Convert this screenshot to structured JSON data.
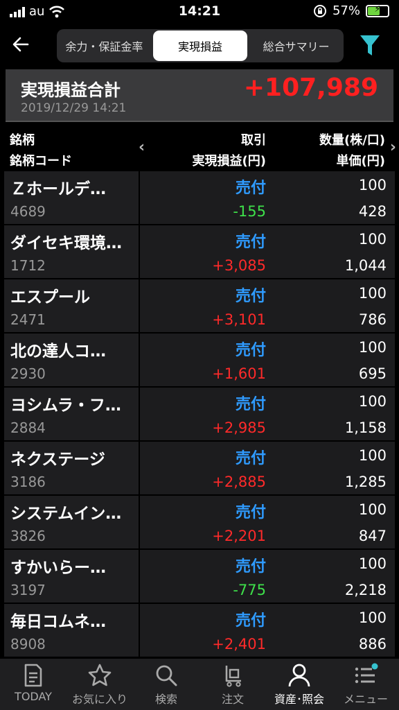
{
  "status": {
    "carrier": "au",
    "time": "14:21",
    "battery": "57%"
  },
  "header": {
    "tabs": [
      {
        "label": "余力・保証金率",
        "active": false
      },
      {
        "label": "実現損益",
        "active": true
      },
      {
        "label": "総合サマリー",
        "active": false
      }
    ]
  },
  "summary": {
    "title": "実現損益合計",
    "date": "2019/12/29 14:21",
    "total": "+107,989"
  },
  "columns": {
    "name": "銘柄",
    "code": "銘柄コード",
    "trade": "取引",
    "pl": "実現損益(円)",
    "qty": "数量(株/口)",
    "price": "単価(円)"
  },
  "rows": [
    {
      "name": "Ｚホールデ…",
      "code": "4689",
      "side": "売付",
      "pl": "-155",
      "qty": "100",
      "price": "428"
    },
    {
      "name": "ダイセキ環境…",
      "code": "1712",
      "side": "売付",
      "pl": "+3,085",
      "qty": "100",
      "price": "1,044"
    },
    {
      "name": "エスプール",
      "code": "2471",
      "side": "売付",
      "pl": "+3,101",
      "qty": "100",
      "price": "786"
    },
    {
      "name": "北の達人コ…",
      "code": "2930",
      "side": "売付",
      "pl": "+1,601",
      "qty": "100",
      "price": "695"
    },
    {
      "name": "ヨシムラ・フ…",
      "code": "2884",
      "side": "売付",
      "pl": "+2,985",
      "qty": "100",
      "price": "1,158"
    },
    {
      "name": "ネクステージ",
      "code": "3186",
      "side": "売付",
      "pl": "+2,885",
      "qty": "100",
      "price": "1,285"
    },
    {
      "name": "システムイン…",
      "code": "3826",
      "side": "売付",
      "pl": "+2,201",
      "qty": "100",
      "price": "847"
    },
    {
      "name": "すかいらー…",
      "code": "3197",
      "side": "売付",
      "pl": "-775",
      "qty": "100",
      "price": "2,218"
    },
    {
      "name": "毎日コムネ…",
      "code": "8908",
      "side": "売付",
      "pl": "+2,401",
      "qty": "100",
      "price": "886"
    }
  ],
  "nav": [
    {
      "label": "TODAY",
      "icon": "document-icon",
      "active": false
    },
    {
      "label": "お気に入り",
      "icon": "star-icon",
      "active": false
    },
    {
      "label": "検索",
      "icon": "search-icon",
      "active": false
    },
    {
      "label": "注文",
      "icon": "cart-icon",
      "active": false
    },
    {
      "label": "資産･照会",
      "icon": "person-icon",
      "active": true
    },
    {
      "label": "メニュー",
      "icon": "menu-icon",
      "active": false
    }
  ],
  "colors": {
    "positive": "#ff2a2a",
    "negative": "#3ee04a",
    "trade": "#2f9bff",
    "filter": "#36c2cf"
  }
}
